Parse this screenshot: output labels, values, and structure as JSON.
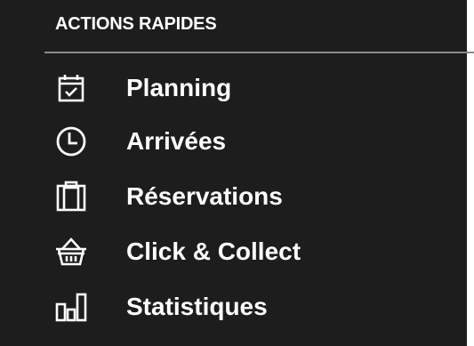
{
  "panel": {
    "title": "ACTIONS RAPIDES",
    "background": "#1d1d1d",
    "divider_color": "#8a8a8a"
  },
  "menu": {
    "items": [
      {
        "label": "Planning",
        "icon": "calendar-check-icon"
      },
      {
        "label": "Arrivées",
        "icon": "clock-icon"
      },
      {
        "label": "Réservations",
        "icon": "clipboard-icon"
      },
      {
        "label": "Click & Collect",
        "icon": "basket-icon"
      },
      {
        "label": "Statistiques",
        "icon": "bar-chart-icon"
      }
    ]
  }
}
